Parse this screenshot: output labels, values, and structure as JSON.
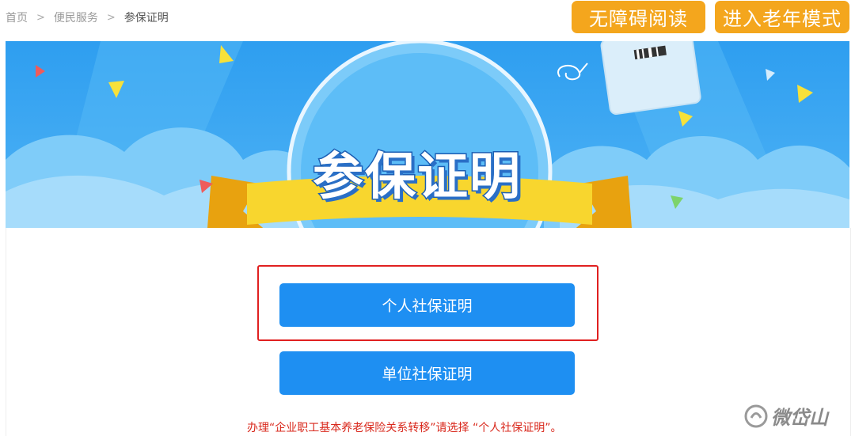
{
  "breadcrumb": {
    "home": "首页",
    "section": "便民服务",
    "current": "参保证明"
  },
  "header_buttons": {
    "accessibility": "无障碍阅读",
    "elderly_mode": "进入老年模式"
  },
  "banner": {
    "title": "参保证明"
  },
  "actions": {
    "personal": "个人社保证明",
    "company": "单位社保证明"
  },
  "notice": "办理“企业职工基本养老保险关系转移”请选择 “个人社保证明”。",
  "watermark": {
    "text": "微岱山",
    "icon": "watermark-logo-icon"
  },
  "colors": {
    "accent_orange": "#f4a61d",
    "primary_blue": "#1e8ff2",
    "highlight_red": "#e02020",
    "notice_red": "#d9281c"
  }
}
